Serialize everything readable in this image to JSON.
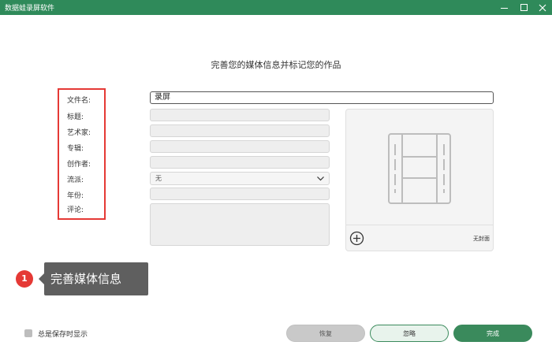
{
  "window": {
    "title": "数据蛙录屏软件"
  },
  "heading": "完善您的媒体信息并标记您的作品",
  "form": {
    "labels": [
      "文件名:",
      "标题:",
      "艺术家:",
      "专辑:",
      "创作者:",
      "流派:",
      "年份:",
      "评论:"
    ],
    "filename_value": "录屏",
    "genre_value": "无"
  },
  "cover": {
    "no_cover_label": "无封面"
  },
  "annotation": {
    "step_number": "1",
    "step_text": "完善媒体信息"
  },
  "footer": {
    "always_show_label": "总是保存时显示",
    "restore_label": "恢复",
    "ignore_label": "忽略",
    "done_label": "完成"
  },
  "colors": {
    "titlebar": "#2f8a5a",
    "accent": "#3a8a5c",
    "highlight": "#e53935"
  }
}
